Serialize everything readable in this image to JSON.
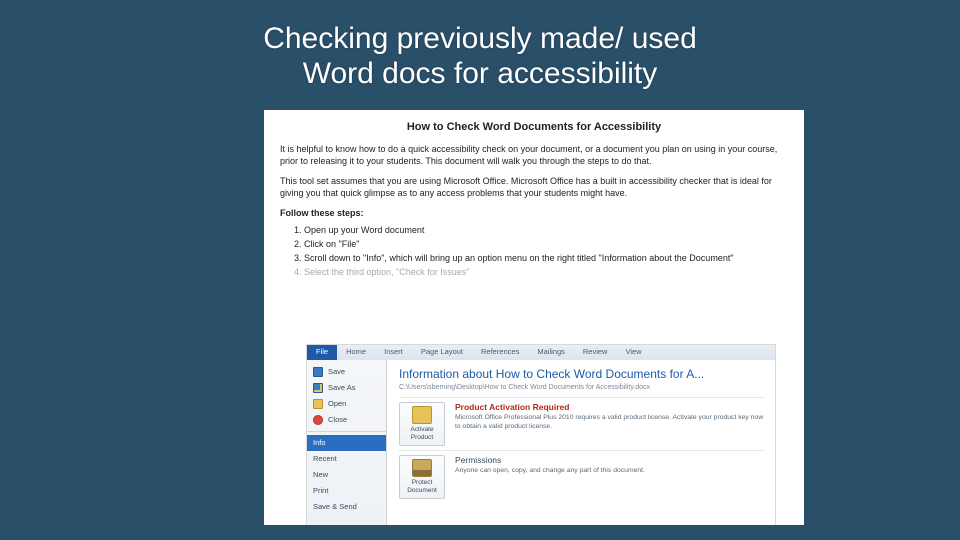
{
  "slide": {
    "title_line1": "Checking previously made/ used",
    "title_line2": "Word docs for accessibility"
  },
  "doc": {
    "heading": "How to Check Word Documents for Accessibility",
    "para1": "It is helpful to know how to do a quick accessibility check on your document, or a document you plan on using in your course, prior to releasing it to your students. This document will walk you through the steps to do that.",
    "para2": "This tool set assumes that you are using Microsoft Office. Microsoft Office has a built in accessibility checker that is ideal for giving you that quick glimpse as to any access problems that your students might have.",
    "follow": "Follow these steps:",
    "steps": [
      "Open up your Word document",
      "Click on \"File\"",
      "Scroll down to \"Info\", which will bring up an option menu on the right titled \"Information about the Document\"",
      "Select the third option, \"Check for Issues\""
    ]
  },
  "shot": {
    "tabs": [
      "File",
      "Home",
      "Insert",
      "Page Layout",
      "References",
      "Mailings",
      "Review",
      "View"
    ],
    "sidebar": {
      "save": "Save",
      "saveas": "Save As",
      "open": "Open",
      "close": "Close",
      "info": "Info",
      "recent": "Recent",
      "new": "New",
      "print": "Print",
      "savesend": "Save & Send"
    },
    "info_title": "Information about How to Check Word Documents for A...",
    "info_path": "C:\\Users\\sberning\\Desktop\\How to Check Word Documents for Accessibility.docx",
    "activate": {
      "btn": "Activate Product",
      "hd": "Product Activation Required",
      "bd": "Microsoft Office Professional Plus 2010 requires a valid product license. Activate your product key now to obtain a valid product license."
    },
    "protect": {
      "btn": "Protect Document",
      "hd": "Permissions",
      "bd": "Anyone can open, copy, and change any part of this document."
    }
  }
}
